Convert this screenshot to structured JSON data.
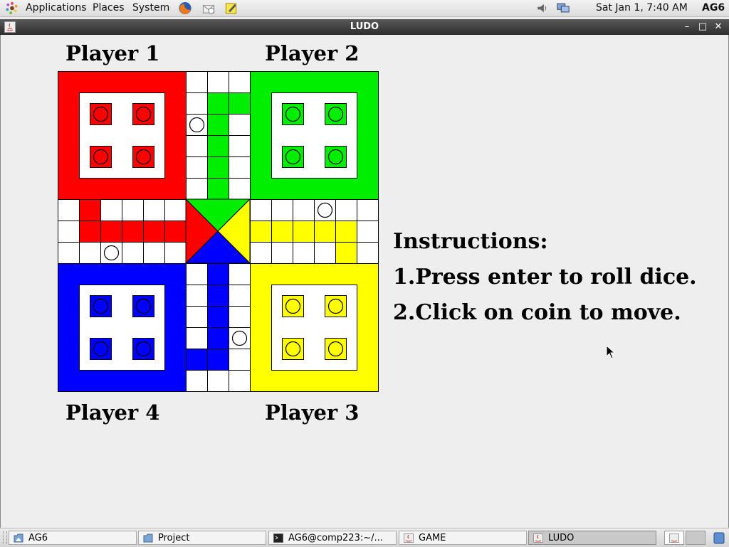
{
  "top_panel": {
    "menus": [
      "Applications",
      "Places",
      "System"
    ],
    "clock": "Sat Jan  1,  7:40 AM",
    "user": "AG6",
    "launcher_icons": [
      "firefox-icon",
      "mail-icon",
      "notes-icon"
    ],
    "tray_icons": [
      "volume-icon",
      "network-icon"
    ]
  },
  "window": {
    "title": "LUDO",
    "controls": [
      "minimize",
      "maximize",
      "close"
    ]
  },
  "game": {
    "players": {
      "p1": "Player 1",
      "p2": "Player 2",
      "p3": "Player 3",
      "p4": "Player 4"
    },
    "instructions": {
      "heading": "Instructions:",
      "line1": "1.Press enter to roll dice.",
      "line2": "2.Click on coin to move."
    },
    "colors": {
      "red": "#ff0000",
      "green": "#00ee00",
      "yellow": "#ffff00",
      "blue": "#0000ff"
    }
  },
  "taskbar": {
    "items": [
      {
        "label": "AG6",
        "icon": "home-folder-icon"
      },
      {
        "label": "Project",
        "icon": "folder-icon"
      },
      {
        "label": "AG6@comp223:~/...",
        "icon": "terminal-icon"
      },
      {
        "label": "GAME",
        "icon": "java-app-icon"
      },
      {
        "label": "LUDO",
        "icon": "java-app-icon",
        "active": true
      }
    ]
  }
}
